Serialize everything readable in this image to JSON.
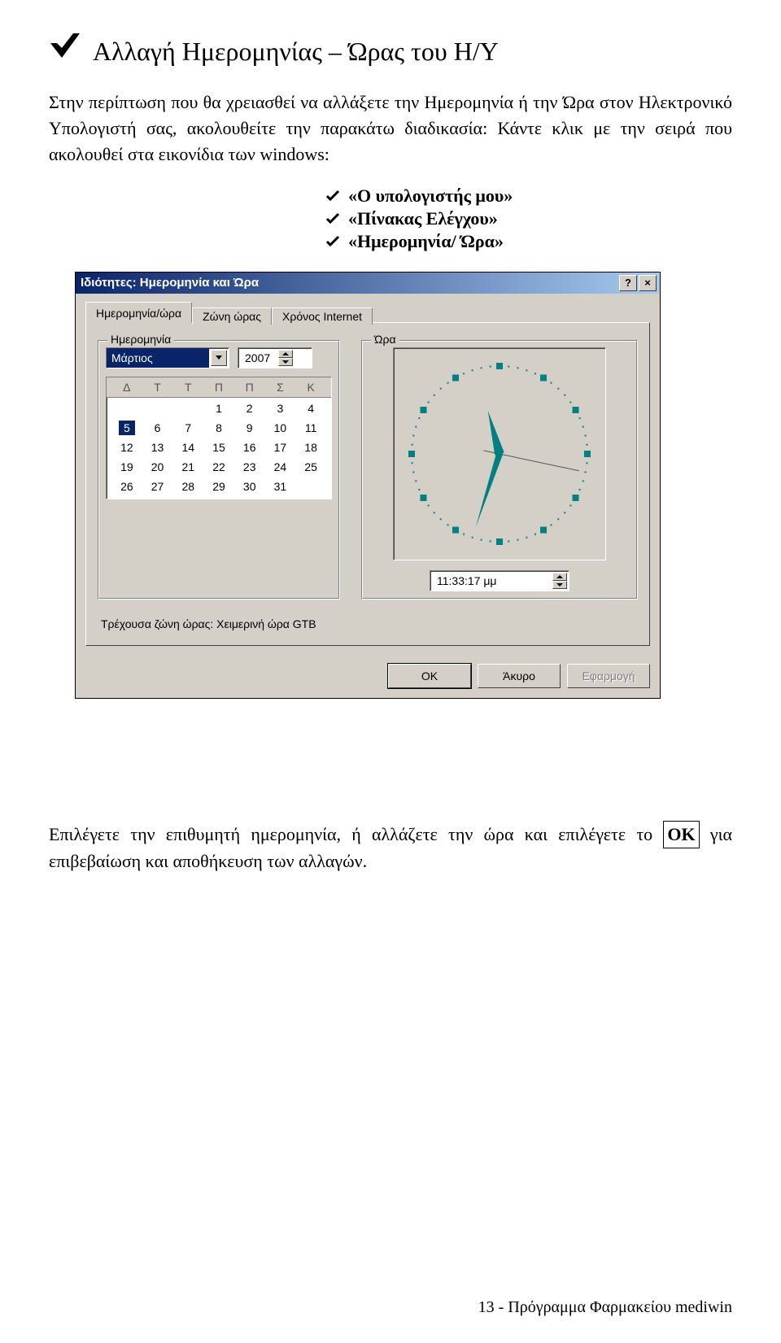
{
  "doc": {
    "title": "Αλλαγή Ημερομηνίας – Ώρας του Η/Υ",
    "intro": "Στην περίπτωση που θα χρειασθεί να αλλάξετε την Ημερομηνία ή την Ώρα στον Ηλεκτρονικό Υπολογιστή σας, ακολουθείτε την παρακάτω διαδικασία: Κάντε κλικ με την σειρά που ακολουθεί στα εικονίδια των windows:",
    "checklist": [
      "«Ο υπολογιστής μου»",
      "«Πίνακας Ελέγχου»",
      "«Ημερομηνία/ Ώρα»"
    ],
    "outro_before": "Επιλέγετε την επιθυμητή ημερομηνία, ή αλλάζετε την ώρα και επιλέγετε το ",
    "outro_ok": "ΟΚ",
    "outro_after": " για επιβεβαίωση και αποθήκευση των αλλαγών.",
    "footer": "13 -  Πρόγραμμα Φαρμακείου mediwin"
  },
  "dialog": {
    "title": "Ιδιότητες: Ημερομηνία και Ώρα",
    "help_btn": "?",
    "close_btn": "×",
    "tabs": {
      "date_time": "Ημερομηνία/ώρα",
      "timezone": "Ζώνη ώρας",
      "internet": "Χρόνος Internet"
    },
    "date_group_label": "Ημερομηνία",
    "time_group_label": "Ώρα",
    "month": "Μάρτιος",
    "year": "2007",
    "weekdays": [
      "Δ",
      "Τ",
      "Τ",
      "Π",
      "Π",
      "Σ",
      "Κ"
    ],
    "calendar": [
      [
        "",
        "",
        "",
        "1",
        "2",
        "3",
        "4"
      ],
      [
        "5",
        "6",
        "7",
        "8",
        "9",
        "10",
        "11"
      ],
      [
        "12",
        "13",
        "14",
        "15",
        "16",
        "17",
        "18"
      ],
      [
        "19",
        "20",
        "21",
        "22",
        "23",
        "24",
        "25"
      ],
      [
        "26",
        "27",
        "28",
        "29",
        "30",
        "31",
        ""
      ]
    ],
    "selected_day": "5",
    "time_value": "11:33:17 μμ",
    "tz_label": "Τρέχουσα ζώνη ώρας:  Χειμερινή ώρα GTB",
    "buttons": {
      "ok": "OK",
      "cancel": "Άκυρο",
      "apply": "Εφαρμογή"
    },
    "clock": {
      "hour_angle": 345,
      "minute_angle": 198,
      "second_angle": 102,
      "tick_color": "#008080"
    }
  }
}
